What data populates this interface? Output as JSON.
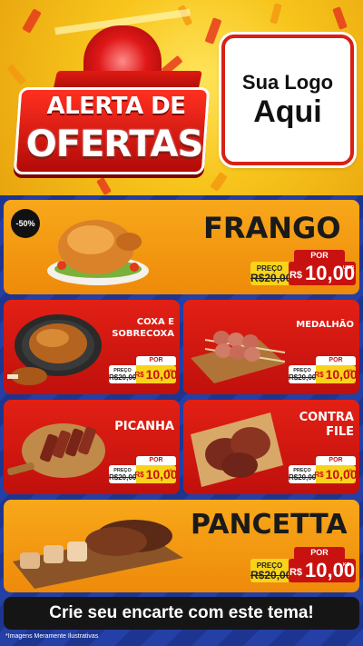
{
  "header": {
    "banner_line1": "ALERTA DE",
    "banner_line2": "OFERTAS",
    "logo_line1": "Sua Logo",
    "logo_line2": "Aqui"
  },
  "products": [
    {
      "name": "FRANGO",
      "badge": "-50%",
      "por_label": "POR",
      "preco_label": "PREÇO",
      "old_price": "R$20,00",
      "currency": "R$",
      "price": "10,00",
      "unit": "UNID",
      "image": "roast-chicken-image"
    },
    {
      "name_line1": "COXA E",
      "name_line2": "SOBRECOXA",
      "por_label": "POR",
      "preco_label": "PREÇO",
      "old_price": "R$20,00",
      "currency": "R$",
      "price": "10,00",
      "unit": "KG",
      "image": "roast-drumstick-image"
    },
    {
      "name": "MEDALHÃO",
      "por_label": "POR",
      "preco_label": "PREÇO",
      "old_price": "R$20,00",
      "currency": "R$",
      "price": "10,00",
      "unit": "KG",
      "image": "bacon-skewers-image"
    },
    {
      "name": "PICANHA",
      "por_label": "POR",
      "preco_label": "PREÇO",
      "old_price": "R$20,00",
      "currency": "R$",
      "price": "10,00",
      "unit": "KG",
      "image": "sliced-picanha-image"
    },
    {
      "name_line1": "CONTRA",
      "name_line2": "FILE",
      "por_label": "POR",
      "preco_label": "PREÇO",
      "old_price": "R$20,00",
      "currency": "R$",
      "price": "10,00",
      "unit": "KG",
      "image": "steaks-image"
    },
    {
      "name": "PANCETTA",
      "por_label": "POR",
      "preco_label": "PREÇO",
      "old_price": "R$20,00",
      "currency": "R$",
      "price": "10,00",
      "unit": "KG",
      "image": "pancetta-image"
    }
  ],
  "cta": "Crie seu encarte com este tema!",
  "disclaimer": "*Imagens Meramente Ilustrativas",
  "colors": {
    "brand_red": "#c81210",
    "orange": "#f8a81a",
    "yellow": "#f9d31a",
    "blue": "#1d3590"
  }
}
